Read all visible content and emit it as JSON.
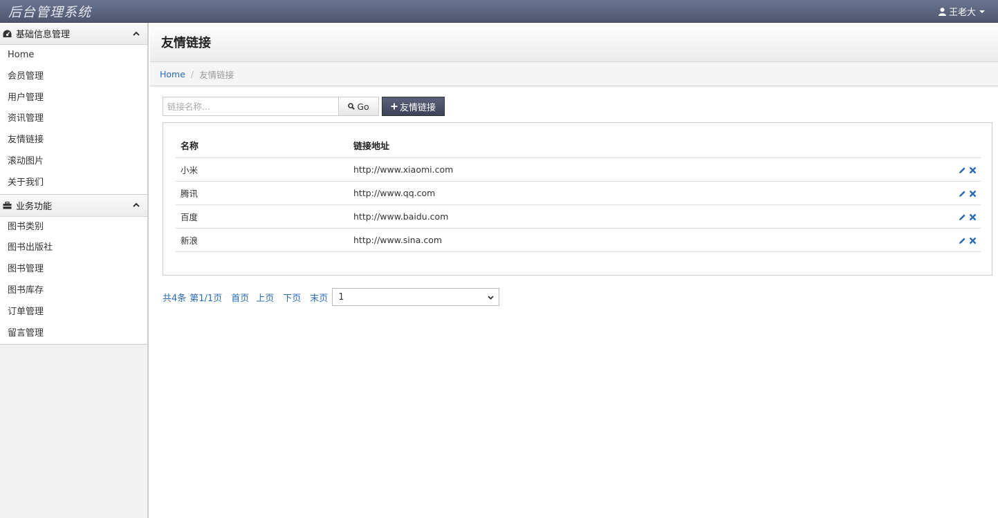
{
  "app": {
    "title": "后台管理系统"
  },
  "user": {
    "name": "王老大"
  },
  "sidebar": {
    "groups": [
      {
        "title": "基础信息管理",
        "icon": "dashboard-icon",
        "items": [
          "Home",
          "会员管理",
          "用户管理",
          "资讯管理",
          "友情链接",
          "滚动图片",
          "关于我们"
        ]
      },
      {
        "title": "业务功能",
        "icon": "briefcase-icon",
        "items": [
          "图书类别",
          "图书出版社",
          "图书管理",
          "图书库存",
          "订单管理",
          "留言管理"
        ]
      }
    ]
  },
  "page": {
    "title": "友情链接"
  },
  "breadcrumb": {
    "home": "Home",
    "separator": "/",
    "current": "友情链接"
  },
  "toolbar": {
    "search_placeholder": "链接名称...",
    "go_label": "Go",
    "add_label": "友情链接"
  },
  "table": {
    "headers": [
      "名称",
      "链接地址"
    ],
    "rows": [
      {
        "name": "小米",
        "url": "http://www.xiaomi.com"
      },
      {
        "name": "腾讯",
        "url": "http://www.qq.com"
      },
      {
        "name": "百度",
        "url": "http://www.baidu.com"
      },
      {
        "name": "新浪",
        "url": "http://www.sina.com"
      }
    ]
  },
  "pagination": {
    "total": "共4条",
    "page_info": "第1/1页",
    "first": "首页",
    "prev": "上页",
    "next": "下页",
    "last": "末页",
    "selected_page": "1"
  },
  "colors": {
    "topbar": "#5a627c",
    "link": "#2a6ab0",
    "add_button": "#4a4f66"
  }
}
